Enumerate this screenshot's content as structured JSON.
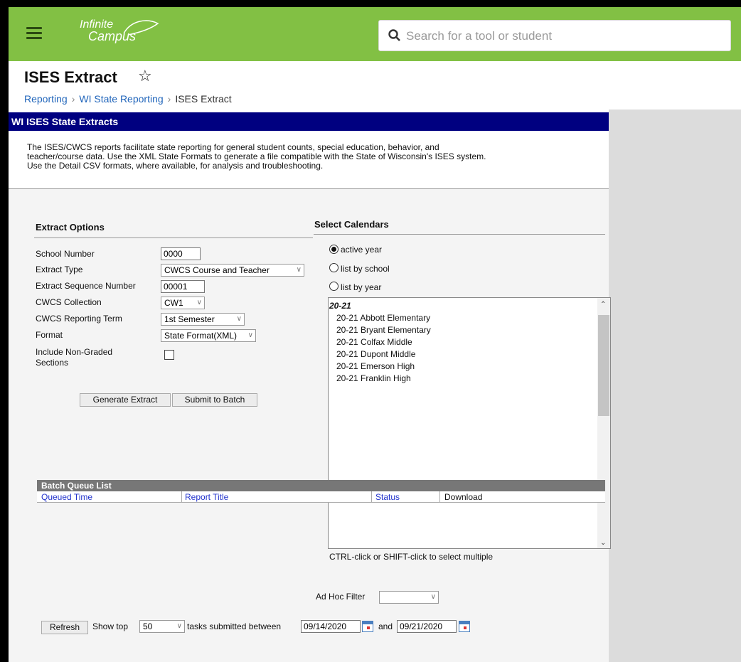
{
  "app": {
    "logo_line1": "Infinite",
    "logo_line2": "Campus"
  },
  "search": {
    "placeholder": "Search for a tool or student"
  },
  "page": {
    "title": "ISES Extract"
  },
  "breadcrumb": [
    "Reporting",
    "WI State Reporting",
    "ISES Extract"
  ],
  "panel": {
    "header": "WI ISES State Extracts",
    "description": [
      "The ISES/CWCS reports facilitate state reporting for general student counts, special education, behavior, and",
      "teacher/course data. Use the XML State Formats to generate a file compatible with the State of Wisconsin's ISES system.",
      "Use the Detail CSV formats, where available, for analysis and troubleshooting."
    ]
  },
  "extract_options": {
    "title": "Extract Options",
    "school_number_label": "School Number",
    "school_number": "0000",
    "extract_type_label": "Extract Type",
    "extract_type": "CWCS Course and Teacher",
    "sequence_label": "Extract Sequence Number",
    "sequence": "00001",
    "collection_label": "CWCS Collection",
    "collection": "CW1",
    "term_label": "CWCS Reporting Term",
    "term": "1st Semester",
    "format_label": "Format",
    "format": "State Format(XML)",
    "nongraded_label_1": "Include Non-Graded",
    "nongraded_label_2": "Sections",
    "generate_button": "Generate Extract",
    "submit_button": "Submit to Batch"
  },
  "calendars": {
    "title": "Select Calendars",
    "radio_active": "active year",
    "radio_school": "list by school",
    "radio_year": "list by year",
    "year": "20-21",
    "items": [
      "20-21 Abbott Elementary",
      "20-21 Bryant Elementary",
      "20-21 Colfax Middle",
      "20-21 Dupont Middle",
      "20-21 Emerson High",
      "20-21 Franklin High"
    ],
    "hint": "CTRL-click or SHIFT-click to select multiple"
  },
  "adhoc": {
    "label": "Ad Hoc Filter",
    "value": ""
  },
  "batch": {
    "refresh": "Refresh",
    "show_top": "Show top",
    "top_value": "50",
    "between": "tasks submitted between",
    "start_date": "09/14/2020",
    "and": "and",
    "end_date": "09/21/2020",
    "title": "Batch Queue List",
    "columns": [
      "Queued Time",
      "Report Title",
      "Status",
      "Download"
    ]
  },
  "colors": {
    "topbar": "#82c044",
    "panel_header": "#000080",
    "link": "#2266bb"
  }
}
